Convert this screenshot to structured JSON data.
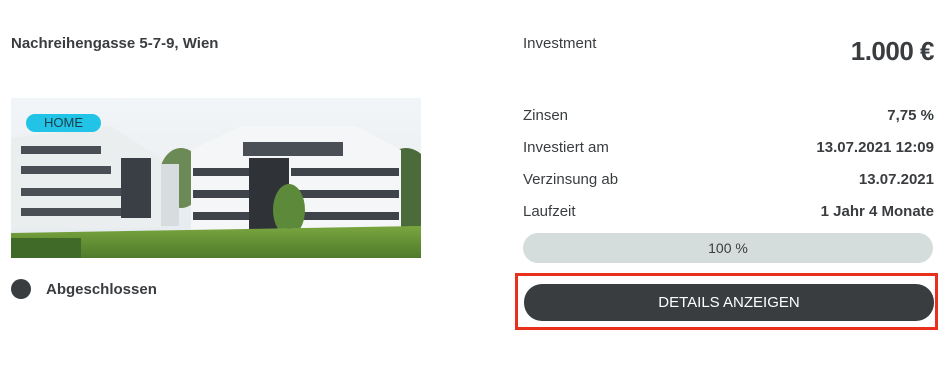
{
  "project": {
    "address": "Nachreihengasse 5-7-9, Wien",
    "badge": "HOME",
    "status": "Abgeschlossen"
  },
  "investment": {
    "label": "Investment",
    "amount": "1.000 €"
  },
  "details": [
    {
      "label": "Zinsen",
      "value": "7,75 %"
    },
    {
      "label": "Investiert am",
      "value": "13.07.2021 12:09"
    },
    {
      "label": "Verzinsung ab",
      "value": "13.07.2021"
    },
    {
      "label": "Laufzeit",
      "value": "1 Jahr 4 Monate"
    }
  ],
  "progress": {
    "text": "100 %",
    "fraction": 1.0
  },
  "actions": {
    "details_button": "DETAILS ANZEIGEN"
  },
  "colors": {
    "text": "#3a3d40",
    "badge": "#21c4e6",
    "progress_track": "#d5dcdc",
    "button": "#3a3d40",
    "highlight": "#e8301c"
  }
}
